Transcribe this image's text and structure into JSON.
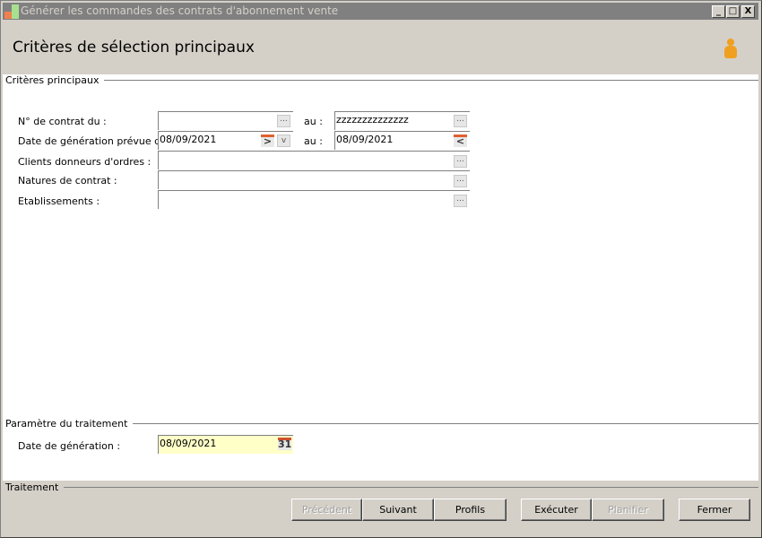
{
  "window": {
    "title": "Générer les commandes des contrats d'abonnement vente",
    "minimize": "_",
    "maximize": "□",
    "close": "X"
  },
  "header": {
    "title": "Critères de sélection principaux"
  },
  "criteria": {
    "section_title": "Critères principaux",
    "contract_from_label": "N° de contrat du :",
    "contract_from_value": "",
    "to_label": "au :",
    "contract_to_value": "zzzzzzzzzzzzzz",
    "date_from_label": "Date de génération prévue du :",
    "date_from_value": "08/09/2021",
    "date_to_value": "08/09/2021",
    "clients_label": "Clients donneurs d'ordres  :",
    "clients_value": "",
    "natures_label": "Natures de contrat :",
    "natures_value": "",
    "etab_label": "Etablissements :",
    "etab_value": ""
  },
  "params": {
    "section_title": "Paramètre du traitement",
    "gen_date_label": "Date de génération :",
    "gen_date_value": "08/09/2021",
    "calendar_day": "31"
  },
  "footer": {
    "section_title": "Traitement",
    "buttons": {
      "previous": "Précédent",
      "next": "Suivant",
      "profiles": "Profils",
      "execute": "Exécuter",
      "schedule": "Planifier",
      "close": "Fermer"
    }
  },
  "icons": {
    "ellipsis": "...",
    "next": ">",
    "prev": "<",
    "down": "v"
  }
}
